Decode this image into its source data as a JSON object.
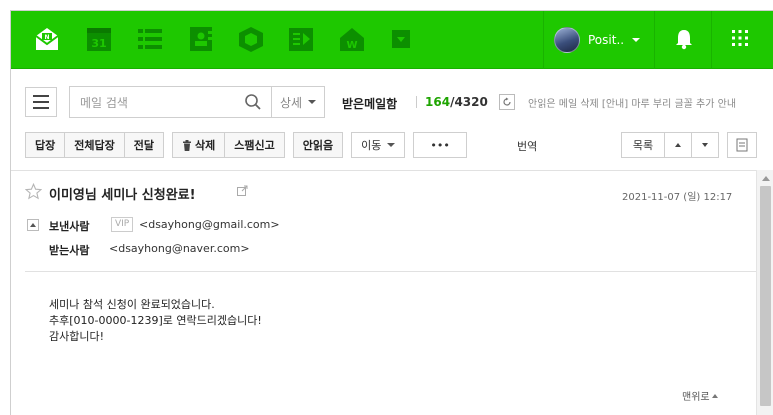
{
  "topbar": {
    "apps": [
      {
        "name": "mail-icon"
      },
      {
        "name": "calendar-icon",
        "text": "31"
      },
      {
        "name": "contacts-list-icon"
      },
      {
        "name": "address-book-icon"
      },
      {
        "name": "box-icon"
      },
      {
        "name": "memo-icon"
      },
      {
        "name": "home-icon"
      },
      {
        "name": "more-apps-icon"
      }
    ],
    "profile_name": "Posit..",
    "colors": {
      "bar": "#1ec800",
      "accent_count": "#1ea400"
    }
  },
  "search": {
    "placeholder": "메일 검색",
    "detail_label": "상세"
  },
  "inbox": {
    "title": "받은메일함",
    "unread": "164",
    "slash": "/",
    "total": "4320",
    "notice": "안읽은 메일 삭제  [안내] 마루 부리 글꼴 추가 안내"
  },
  "toolbar": {
    "reply": "답장",
    "reply_all": "전체답장",
    "forward": "전달",
    "delete": "삭제",
    "spam": "스팸신고",
    "unread": "안읽음",
    "move": "이동",
    "more": "•••",
    "translate": "번역",
    "list": "목록"
  },
  "mail": {
    "subject": "이미영님 세미나 신청완료!",
    "date": "2021-11-07 (일) 12:17",
    "from_label": "보낸사람",
    "vip": "VIP",
    "from_email": "<dsayhong@gmail.com>",
    "to_label": "받는사람",
    "to_email": "<dsayhong@naver.com>",
    "body": [
      "세미나 참석 신청이 완료되었습니다.",
      "추후[010-0000-1239]로 연락드리겠습니다!",
      "감사합니다!"
    ],
    "to_top": "맨위로"
  }
}
